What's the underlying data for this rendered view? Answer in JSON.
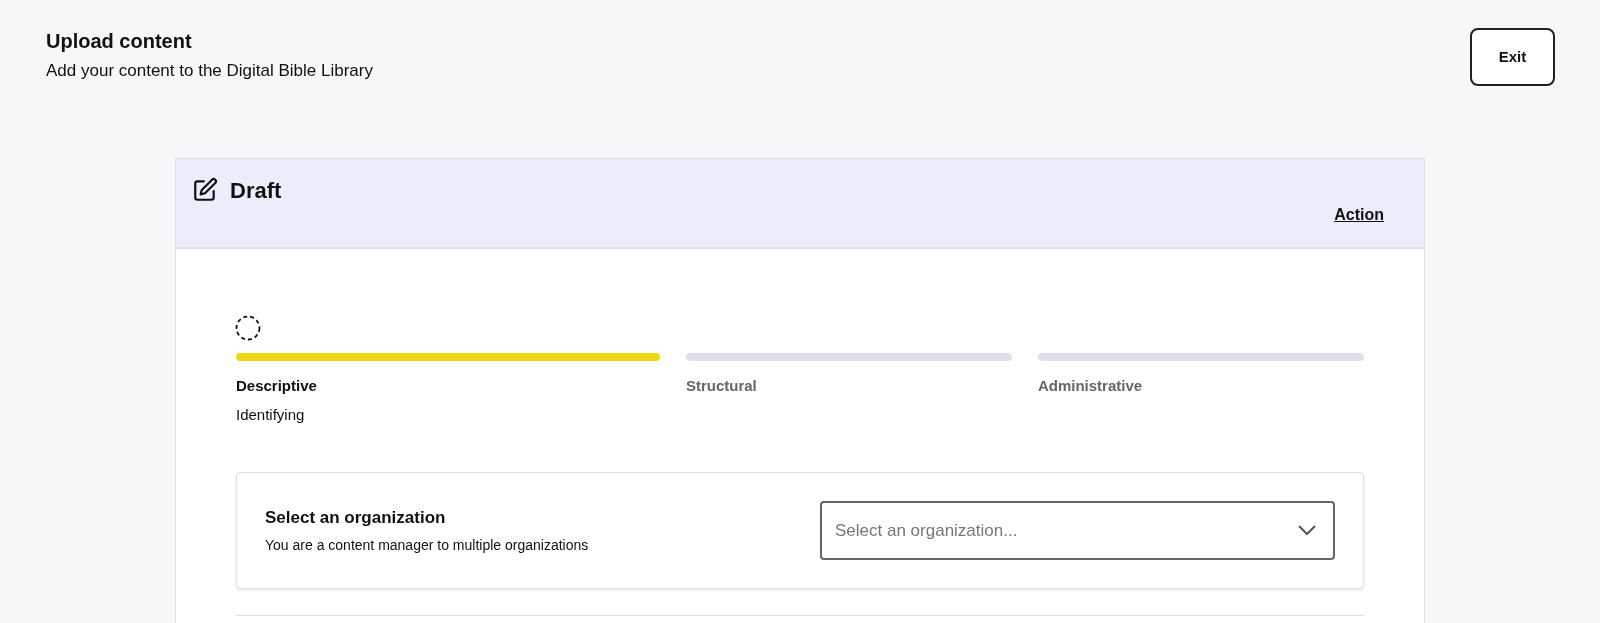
{
  "header": {
    "title": "Upload content",
    "subtitle": "Add your content to the Digital Bible Library",
    "exit_button": "Exit"
  },
  "card": {
    "title": "Draft",
    "action_link": "Action",
    "steps": [
      {
        "label": "Descriptive",
        "sublabel": "Identifying",
        "selected": true
      },
      {
        "label": "Structural",
        "selected": false
      },
      {
        "label": "Administrative",
        "selected": false
      }
    ],
    "organization": {
      "title": "Select an organization",
      "description": "You are a content manager to multiple organizations",
      "dropdown": {
        "placeholder": "Select an organization..."
      }
    }
  }
}
